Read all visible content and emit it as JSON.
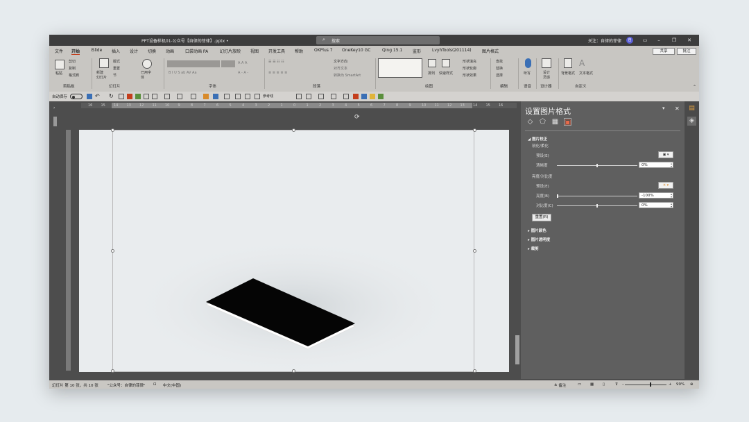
{
  "titlebar": {
    "doc_title": "PPT设备样机01-公众号【自律的菲律】.pptx  •",
    "search_placeholder": "搜索",
    "follow_text": "关注：自律的菲律",
    "avatar_initial": "自"
  },
  "ribbon": {
    "tabs": [
      "文件",
      "开始",
      "iSlide",
      "插入",
      "设计",
      "切换",
      "动画",
      "口袋动画 PA",
      "幻灯片放映",
      "视图",
      "开发工具",
      "帮助",
      "OKPlus 7",
      "OneKey10 GC",
      "Qing 15.1",
      "监形",
      "LvyhTools(201114)",
      "图片格式"
    ],
    "active_tab": "开始",
    "share_label": "共享",
    "comment_label": "批注",
    "groups": {
      "clipboard": "剪贴板",
      "slides": "幻灯片",
      "font": "字体",
      "paragraph": "段落",
      "drawing": "绘图",
      "editing": "编辑",
      "voice": "语音",
      "designer": "设计器",
      "custom": "自定义"
    },
    "buttons": {
      "paste": "粘贴",
      "cut": "剪切",
      "copy": "复制",
      "format_painter": "格式刷",
      "new_slide": "新建\n幻灯片",
      "layout": "版式",
      "reset": "重置",
      "section": "节",
      "reuse_slide": "已用字\n体",
      "text_direction": "文字方向",
      "align_text": "对齐文本",
      "smartart": "转换为 SmartArt",
      "arrange": "排列",
      "quick_styles": "快速样式",
      "shape_fill": "形状填充",
      "shape_outline": "形状轮廓",
      "shape_effects": "形状效果",
      "find": "查找",
      "replace": "替换",
      "select": "选择",
      "dictate": "听写",
      "design_ideas": "设计\n灵感",
      "bg_style": "背景格式",
      "text_style": "文本格式"
    }
  },
  "qat": {
    "autosave_label": "自动保存",
    "toggle_state": "关",
    "ref_line": "参考线"
  },
  "ruler": {
    "h_ticks": [
      "16",
      "15",
      "14",
      "13",
      "12",
      "11",
      "10",
      "9",
      "8",
      "7",
      "6",
      "5",
      "4",
      "3",
      "2",
      "1",
      "0",
      "1",
      "2",
      "3",
      "4",
      "5",
      "6",
      "7",
      "8",
      "9",
      "10",
      "11",
      "12",
      "13",
      "14",
      "15",
      "16"
    ]
  },
  "pane": {
    "title": "设置图片格式",
    "section_correction": "图片校正",
    "sharpen_soften": "锐化/柔化",
    "preset_label_1": "预设(E)",
    "sharpness_label": "清晰度",
    "sharpness_value": "0%",
    "sharpness_level": 0.5,
    "brightness_contrast": "亮度/对比度",
    "preset_label_2": "预设(E)",
    "brightness_label": "亮度(B)",
    "brightness_value": "-100%",
    "brightness_level": 0.0,
    "contrast_label": "对比度(C)",
    "contrast_value": "0%",
    "contrast_level": 0.5,
    "reset_label": "重置(R)",
    "section_color": "图片颜色",
    "section_transparency": "图片透明度",
    "section_crop": "裁剪"
  },
  "statusbar": {
    "slide_info": "幻灯片 第 10 张，共 10 张",
    "theme": "\"公众号：自律的菲律\"",
    "language": "中文(中国)",
    "notes": "备注",
    "zoom": "99%"
  }
}
